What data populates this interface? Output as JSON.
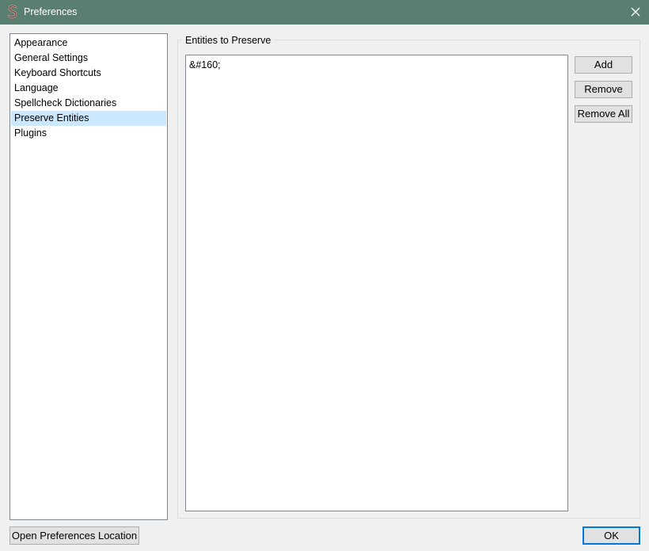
{
  "window": {
    "title": "Preferences",
    "app_icon": "sigil-icon",
    "close_icon": "close-icon"
  },
  "sidebar": {
    "items": [
      {
        "label": "Appearance",
        "selected": false
      },
      {
        "label": "General Settings",
        "selected": false
      },
      {
        "label": "Keyboard Shortcuts",
        "selected": false
      },
      {
        "label": "Language",
        "selected": false
      },
      {
        "label": "Spellcheck Dictionaries",
        "selected": false
      },
      {
        "label": "Preserve Entities",
        "selected": true
      },
      {
        "label": "Plugins",
        "selected": false
      }
    ]
  },
  "main": {
    "group_title": "Entities to Preserve",
    "entities": [
      "&#160;"
    ],
    "buttons": {
      "add": "Add",
      "remove": "Remove",
      "remove_all": "Remove All"
    }
  },
  "footer": {
    "open_location_label": "Open Preferences Location",
    "ok_label": "OK"
  },
  "colors": {
    "titlebar": "#5a7f70",
    "selection": "#cce8ff",
    "focus_border": "#0078d7"
  }
}
